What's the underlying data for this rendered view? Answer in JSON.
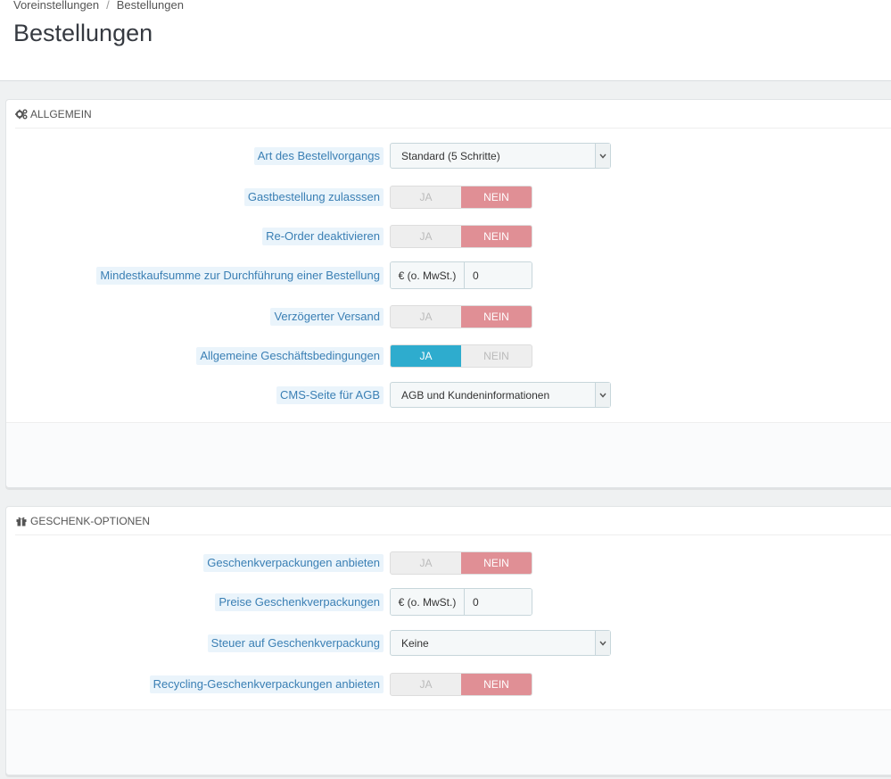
{
  "breadcrumb": {
    "parent": "Voreinstellungen",
    "separator": "/",
    "current": "Bestellungen"
  },
  "page_title": "Bestellungen",
  "general": {
    "heading": "Allgemein",
    "heading_icon": "cogs-icon",
    "order_process_type": {
      "label": "Art des Bestellvorgangs",
      "value": "Standard (5 Schritte)"
    },
    "guest_checkout": {
      "label": "Gastbestellung zulasssen",
      "yes": "JA",
      "no": "NEIN",
      "selected": "no"
    },
    "disable_reorder": {
      "label": "Re-Order deaktivieren",
      "yes": "JA",
      "no": "NEIN",
      "selected": "no"
    },
    "min_purchase": {
      "label": "Mindestkaufsumme zur Durchführung einer Bestellung",
      "addon": "€ (o. MwSt.)",
      "value": "0"
    },
    "delayed_shipping": {
      "label": "Verzögerter Versand",
      "yes": "JA",
      "no": "NEIN",
      "selected": "no"
    },
    "terms": {
      "label": "Allgemeine Geschäftsbedingungen",
      "yes": "JA",
      "no": "NEIN",
      "selected": "yes"
    },
    "cms_terms_page": {
      "label": "CMS-Seite für AGB",
      "value": "AGB und Kundeninformationen"
    }
  },
  "gift": {
    "heading": "Geschenk-Optionen",
    "heading_icon": "gift-icon",
    "offer_gift_wrap": {
      "label": "Geschenkverpackungen anbieten",
      "yes": "JA",
      "no": "NEIN",
      "selected": "no"
    },
    "gift_wrap_price": {
      "label": "Preise Geschenkverpackungen",
      "addon": "€ (o. MwSt.)",
      "value": "0"
    },
    "gift_wrap_tax": {
      "label": "Steuer auf Geschenkverpackung",
      "value": "Keine"
    },
    "recycled_packaging": {
      "label": "Recycling-Geschenkverpackungen anbieten",
      "yes": "JA",
      "no": "NEIN",
      "selected": "no"
    }
  },
  "colors": {
    "no_active": "#e08f95",
    "yes_active": "#2eacce",
    "label_bg": "#eaf4fb",
    "label_text": "#3a7fb4"
  }
}
